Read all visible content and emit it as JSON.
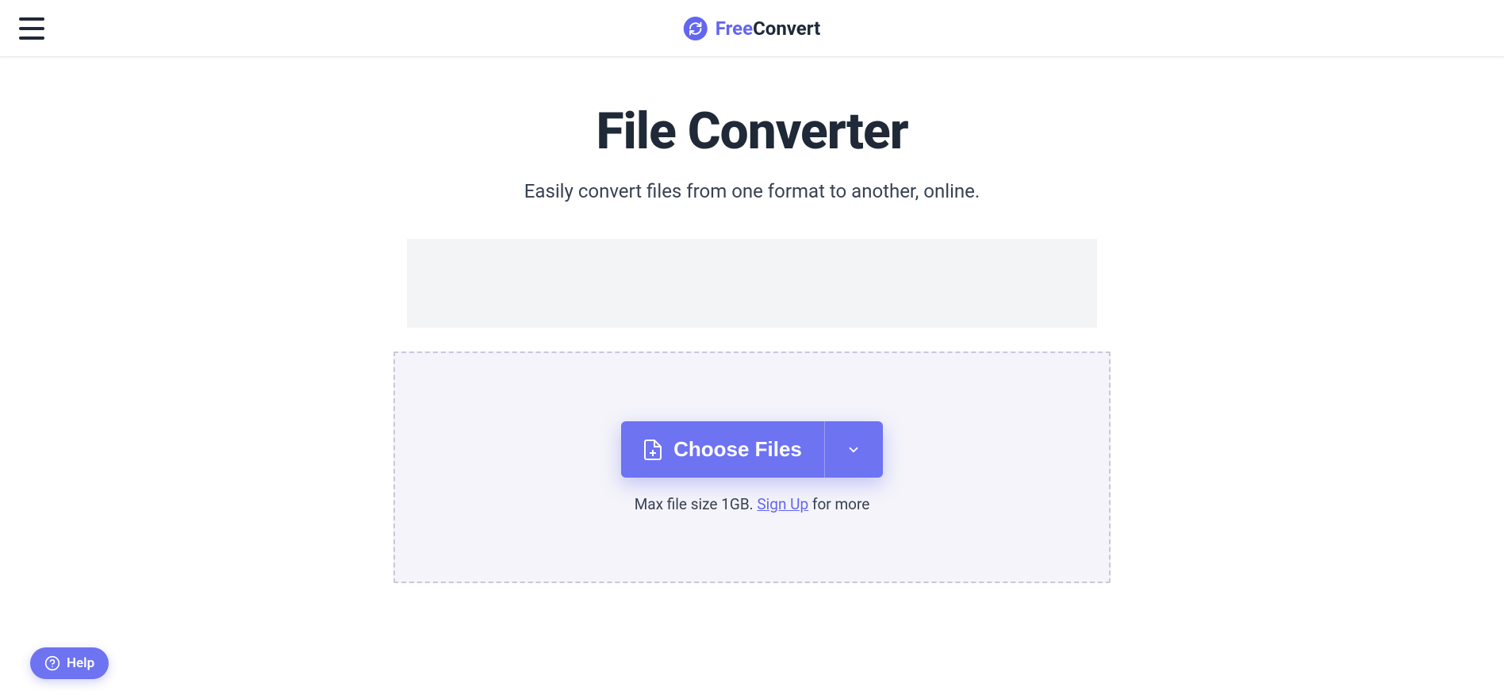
{
  "header": {
    "logo_part1": "Free",
    "logo_part2": "Convert"
  },
  "main": {
    "title": "File Converter",
    "subtitle": "Easily convert files from one format to another, online.",
    "choose_files_label": "Choose Files",
    "size_note_prefix": "Max file size 1GB. ",
    "signup_label": "Sign Up",
    "size_note_suffix": " for more"
  },
  "help": {
    "label": "Help"
  },
  "colors": {
    "primary": "#6d73f1",
    "text_dark": "#1f2937"
  }
}
